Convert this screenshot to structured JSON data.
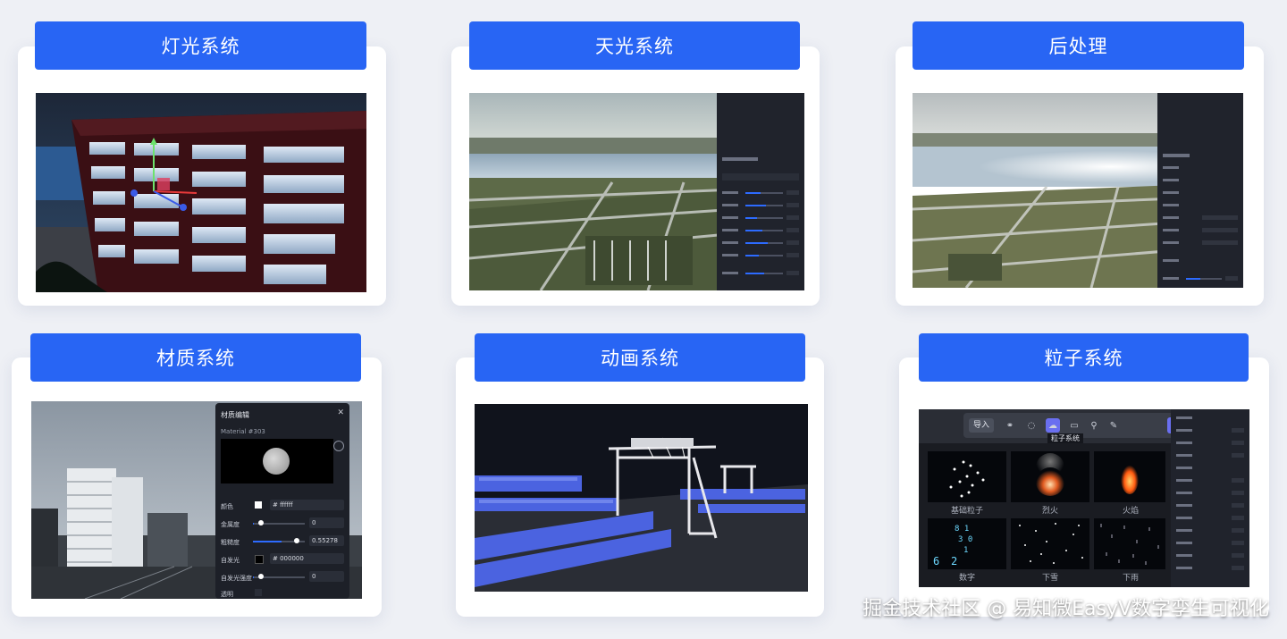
{
  "cards": {
    "lighting": {
      "title": "灯光系统"
    },
    "skylight": {
      "title": "天光系统"
    },
    "postprocess": {
      "title": "后处理"
    },
    "material": {
      "title": "材质系统"
    },
    "animation": {
      "title": "动画系统"
    },
    "particle": {
      "title": "粒子系统"
    }
  },
  "material_editor": {
    "header": "材质编辑",
    "subtitle": "Material #303",
    "rows": [
      {
        "name": "颜色",
        "value": "# ffffff"
      },
      {
        "name": "金属度",
        "value": "0"
      },
      {
        "name": "粗糙度",
        "value": "0.55278"
      },
      {
        "name": "自发光",
        "value": "# 000000"
      },
      {
        "name": "自发光强度",
        "value": "0"
      },
      {
        "name": "透明",
        "value": ""
      }
    ]
  },
  "particle_ui": {
    "toolbar_import": "导入",
    "tooltip": "粒子系统",
    "cells": [
      "基础粒子",
      "烈火",
      "火焰",
      "数字",
      "下雪",
      "下雨"
    ]
  },
  "watermark": "掘金技术社区 @ 易知微EasyV数字孪生可视化",
  "colors": {
    "accent": "#2865f4",
    "card_bg": "#ffffff",
    "page_bg": "#eef0f5"
  }
}
